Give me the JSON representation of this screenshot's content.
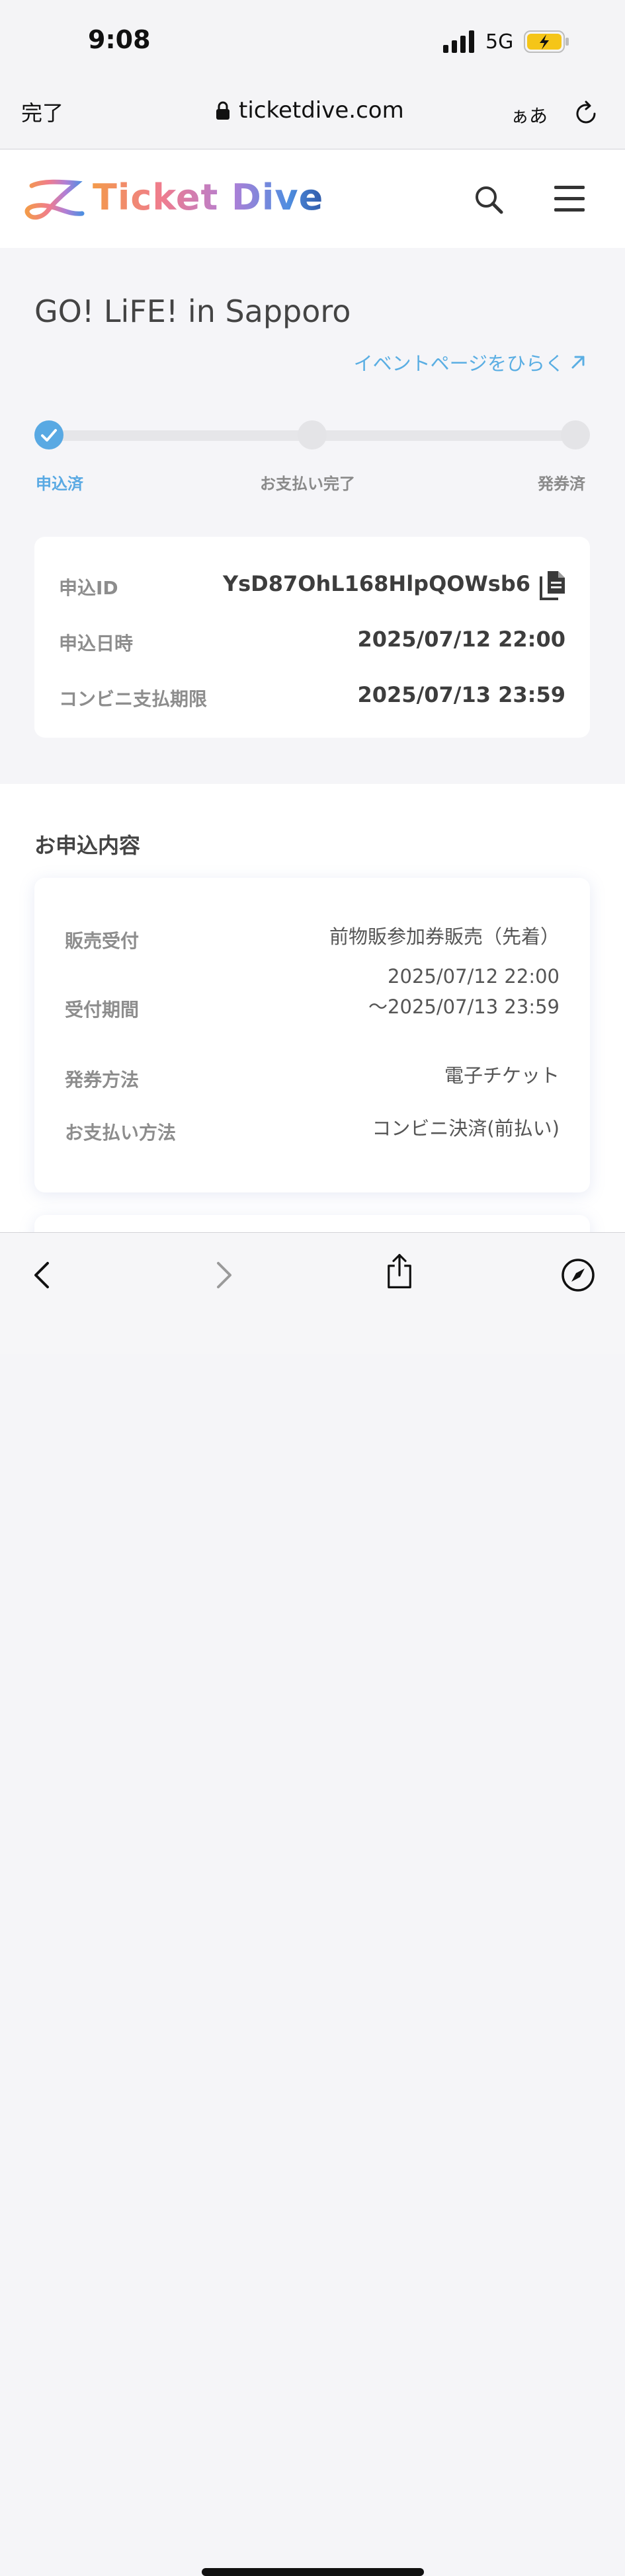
{
  "status_bar": {
    "time": "9:08",
    "network": "5G"
  },
  "browser": {
    "done_label": "完了",
    "url": "ticketdive.com",
    "text_size_label": "ぁあ"
  },
  "site": {
    "logo_text": "Ticket Dive"
  },
  "event": {
    "title": "GO! LiFE! in Sapporo",
    "link_label": "イベントページをひらく"
  },
  "progress": {
    "steps": [
      {
        "label": "申込済",
        "done": true
      },
      {
        "label": "お支払い完了",
        "done": false
      },
      {
        "label": "発券済",
        "done": false
      }
    ]
  },
  "application": {
    "id_label": "申込ID",
    "id_value": "YsD87OhL168HlpQOWsb6",
    "date_label": "申込日時",
    "date_value": "2025/07/12 22:00",
    "deadline_label": "コンビニ支払期限",
    "deadline_value": "2025/07/13 23:59"
  },
  "details": {
    "section_title": "お申込内容",
    "rows": [
      {
        "label": "販売受付",
        "value": "前物販参加券販売（先着）"
      },
      {
        "label": "受付期間",
        "value_line1": "2025/07/12 22:00",
        "value_line2": "〜2025/07/13 23:59"
      },
      {
        "label": "発券方法",
        "value": "電子チケット"
      },
      {
        "label": "お支払い方法",
        "value": "コンビニ決済(前払い)"
      }
    ]
  },
  "colors": {
    "accent": "#59a9e3",
    "link": "#5aaee3",
    "battery": "#f5c518"
  }
}
